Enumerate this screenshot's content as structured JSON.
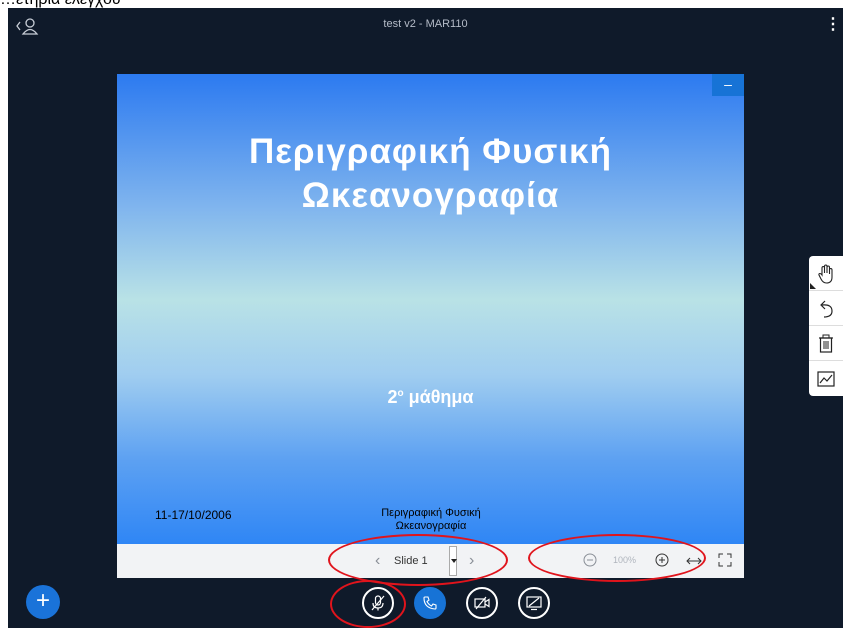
{
  "cut_text": "…ετήρια ελέγχου",
  "header": {
    "title": "test v2 - MAR110",
    "menu_label": "⋮"
  },
  "slide": {
    "title_line1": "Περιγραφική Φυσική",
    "title_line2": "Ωκεανογραφία",
    "subtitle_num": "2",
    "subtitle_sup": "ο",
    "subtitle_text": " μάθημα",
    "date": "11-17/10/2006",
    "footer_line1": "Περιγραφική Φυσική",
    "footer_line2": "Ωκεανογραφία",
    "minimize_label": "–"
  },
  "controls": {
    "prev_label": "‹",
    "slide_label": "Slide 1",
    "next_label": "›",
    "zoom_level": "100%"
  },
  "bottom": {
    "plus_label": "+"
  },
  "colors": {
    "app_bg": "#0f1a2a",
    "accent": "#1773d6",
    "annotation": "#e0141c"
  }
}
